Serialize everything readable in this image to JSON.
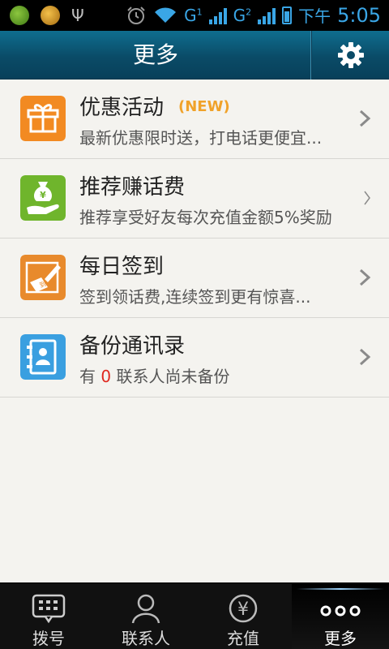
{
  "status_bar": {
    "net1": "G",
    "net1_sup": "1",
    "net2": "G",
    "net2_sup": "2",
    "ampm": "下午",
    "time": "5:05"
  },
  "header": {
    "title": "更多"
  },
  "items": [
    {
      "title": "优惠活动",
      "badge": "(NEW)",
      "subtitle": "最新优惠限时送，打电话更便宜..."
    },
    {
      "title": "推荐赚话费",
      "subtitle": "推荐享受好友每次充值金额5%奖励"
    },
    {
      "title": "每日签到",
      "subtitle": "签到领话费,连续签到更有惊喜..."
    },
    {
      "title": "备份通讯录",
      "sub_pre": "有",
      "sub_num": "0",
      "sub_post": "联系人尚未备份"
    }
  ],
  "tabs": [
    {
      "label": "拨号"
    },
    {
      "label": "联系人"
    },
    {
      "label": "充值"
    },
    {
      "label": "更多"
    }
  ],
  "colors": {
    "header_bg": "#0a4b67",
    "accent": "#3aa6e6",
    "new_badge": "#f0a22a",
    "highlight_number": "#e0281f"
  }
}
